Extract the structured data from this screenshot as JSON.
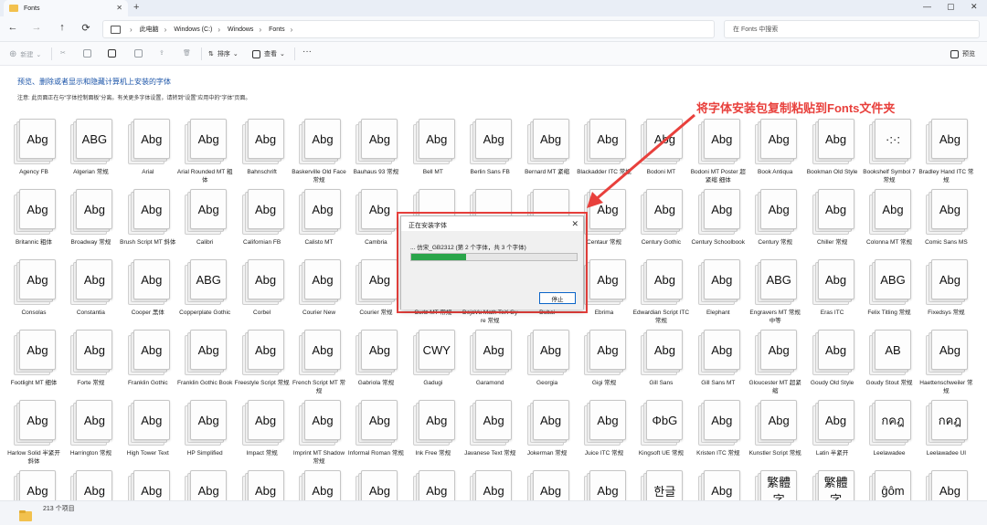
{
  "window": {
    "tab_title": "Fonts",
    "new_tab": "+",
    "controls": [
      "—",
      "▢",
      "✕"
    ]
  },
  "nav": {
    "back": "←",
    "forward": "→",
    "up": "↑",
    "refresh": "⟳",
    "breadcrumbs": [
      "此电脑",
      "Windows (C:)",
      "Windows",
      "Fonts"
    ],
    "search_placeholder": "在 Fonts 中搜索"
  },
  "commands": {
    "new": "新建",
    "sort": "排序",
    "view": "查看",
    "more": "···",
    "preview": "预览"
  },
  "info": {
    "title": "预览、删除或者显示和隐藏计算机上安装的字体",
    "note": "注意: 此页面正在与“字体控制面板”分离。有关更多字体设置，请转到“设置”应用中的“字体”页面。"
  },
  "annotation": {
    "text": "将字体安装包复制粘贴到Fonts文件夹",
    "color": "#e8403c"
  },
  "dialog": {
    "title": "正在安装字体",
    "close": "✕",
    "message": "... 仿宋_GB2312 (第 2 个字体，共 3 个字体)",
    "progress": 0.33,
    "stop_button": "停止"
  },
  "status": {
    "count": "213 个项目"
  },
  "fonts": [
    {
      "sample": "Abg",
      "label": "Agency FB"
    },
    {
      "sample": "ABG",
      "label": "Algerian 常规"
    },
    {
      "sample": "Abg",
      "label": "Arial"
    },
    {
      "sample": "Abg",
      "label": "Arial Rounded MT 粗体"
    },
    {
      "sample": "Abg",
      "label": "Bahnschrift"
    },
    {
      "sample": "Abg",
      "label": "Baskerville Old Face 常规"
    },
    {
      "sample": "Abg",
      "label": "Bauhaus 93 常规"
    },
    {
      "sample": "Abg",
      "label": "Bell MT"
    },
    {
      "sample": "Abg",
      "label": "Berlin Sans FB"
    },
    {
      "sample": "Abg",
      "label": "Bernard MT 紧缩"
    },
    {
      "sample": "Abg",
      "label": "Blackadder ITC 常规"
    },
    {
      "sample": "Abg",
      "label": "Bodoni MT"
    },
    {
      "sample": "Abg",
      "label": "Bodoni MT Poster 超紧缩 细体"
    },
    {
      "sample": "Abg",
      "label": "Book Antiqua"
    },
    {
      "sample": "Abg",
      "label": "Bookman Old Style"
    },
    {
      "sample": "·:·:",
      "label": "Bookshelf Symbol 7 常规"
    },
    {
      "sample": "Abg",
      "label": "Bradley Hand ITC 常规"
    },
    {
      "sample": "Abg",
      "label": "Britannic 粗体"
    },
    {
      "sample": "Abg",
      "label": "Broadway 常规"
    },
    {
      "sample": "Abg",
      "label": "Brush Script MT 斜体"
    },
    {
      "sample": "Abg",
      "label": "Calibri"
    },
    {
      "sample": "Abg",
      "label": "Californian FB"
    },
    {
      "sample": "Abg",
      "label": "Calisto MT"
    },
    {
      "sample": "Abg",
      "label": "Cambria"
    },
    {
      "sample": "",
      "label": ""
    },
    {
      "sample": "",
      "label": ""
    },
    {
      "sample": "",
      "label": ""
    },
    {
      "sample": "Abg",
      "label": "Centaur 常规"
    },
    {
      "sample": "Abg",
      "label": "Century Gothic"
    },
    {
      "sample": "Abg",
      "label": "Century Schoolbook"
    },
    {
      "sample": "Abg",
      "label": "Century 常规"
    },
    {
      "sample": "Abg",
      "label": "Chiller 常规"
    },
    {
      "sample": "Abg",
      "label": "Colonna MT 常规"
    },
    {
      "sample": "Abg",
      "label": "Comic Sans MS"
    },
    {
      "sample": "Abg",
      "label": "Consolas"
    },
    {
      "sample": "Abg",
      "label": "Constantia"
    },
    {
      "sample": "Abg",
      "label": "Cooper 黑体"
    },
    {
      "sample": "ABG",
      "label": "Copperplate Gothic"
    },
    {
      "sample": "Abg",
      "label": "Corbel"
    },
    {
      "sample": "Abg",
      "label": "Courier New"
    },
    {
      "sample": "Abg",
      "label": "Courier 常规"
    },
    {
      "sample": "",
      "label": "Curlz MT 常规"
    },
    {
      "sample": "",
      "label": "DejaVu Math TeX Gyre 常规"
    },
    {
      "sample": "",
      "label": "Dubai"
    },
    {
      "sample": "Abg",
      "label": "Ebrima"
    },
    {
      "sample": "Abg",
      "label": "Edwardian Script ITC 常规"
    },
    {
      "sample": "Abg",
      "label": "Elephant"
    },
    {
      "sample": "ABG",
      "label": "Engravers MT 常规 中等"
    },
    {
      "sample": "Abg",
      "label": "Eras ITC"
    },
    {
      "sample": "ABG",
      "label": "Felix Titling 常规"
    },
    {
      "sample": "Abg",
      "label": "Fixedsys 常规"
    },
    {
      "sample": "Abg",
      "label": "Footlight MT 细体"
    },
    {
      "sample": "Abg",
      "label": "Forte 常规"
    },
    {
      "sample": "Abg",
      "label": "Franklin Gothic"
    },
    {
      "sample": "Abg",
      "label": "Franklin Gothic Book"
    },
    {
      "sample": "Abg",
      "label": "Freestyle Script 常规"
    },
    {
      "sample": "Abg",
      "label": "French Script MT 常规"
    },
    {
      "sample": "Abg",
      "label": "Gabriola 常规"
    },
    {
      "sample": "CWY",
      "label": "Gadugi"
    },
    {
      "sample": "Abg",
      "label": "Garamond"
    },
    {
      "sample": "Abg",
      "label": "Georgia"
    },
    {
      "sample": "Abg",
      "label": "Gigi 常规"
    },
    {
      "sample": "Abg",
      "label": "Gill Sans"
    },
    {
      "sample": "Abg",
      "label": "Gill Sans MT"
    },
    {
      "sample": "Abg",
      "label": "Gloucester MT 超紧缩"
    },
    {
      "sample": "Abg",
      "label": "Goudy Old Style"
    },
    {
      "sample": "AB",
      "label": "Goudy Stout 常规"
    },
    {
      "sample": "Abg",
      "label": "Haettenschweiler 常规"
    },
    {
      "sample": "Abg",
      "label": "Harlow Solid 半紧开 斜体"
    },
    {
      "sample": "Abg",
      "label": "Harrington 常规"
    },
    {
      "sample": "Abg",
      "label": "High Tower Text"
    },
    {
      "sample": "Abg",
      "label": "HP Simplified"
    },
    {
      "sample": "Abg",
      "label": "Impact 常规"
    },
    {
      "sample": "Abg",
      "label": "Imprint MT Shadow 常规"
    },
    {
      "sample": "Abg",
      "label": "Informal Roman 常规"
    },
    {
      "sample": "Abg",
      "label": "Ink Free 常规"
    },
    {
      "sample": "Abg",
      "label": "Javanese Text 常规"
    },
    {
      "sample": "Abg",
      "label": "Jokerman 常规"
    },
    {
      "sample": "Abg",
      "label": "Juice ITC 常规"
    },
    {
      "sample": "ΦbG",
      "label": "Kingsoft UE 常规"
    },
    {
      "sample": "Abg",
      "label": "Kristen ITC 常规"
    },
    {
      "sample": "Abg",
      "label": "Kunstler Script 常规"
    },
    {
      "sample": "Abg",
      "label": "Latin 半紧开"
    },
    {
      "sample": "กคฎ",
      "label": "Leelawadee"
    },
    {
      "sample": "กคฎ",
      "label": "Leelawadee UI"
    },
    {
      "sample": "Abg",
      "label": ""
    },
    {
      "sample": "Abg",
      "label": ""
    },
    {
      "sample": "Abg",
      "label": ""
    },
    {
      "sample": "Abg",
      "label": ""
    },
    {
      "sample": "Abg",
      "label": ""
    },
    {
      "sample": "Abg",
      "label": ""
    },
    {
      "sample": "Abg",
      "label": ""
    },
    {
      "sample": "Abg",
      "label": ""
    },
    {
      "sample": "Abg",
      "label": ""
    },
    {
      "sample": "Abg",
      "label": ""
    },
    {
      "sample": "Abg",
      "label": ""
    },
    {
      "sample": "한글",
      "label": ""
    },
    {
      "sample": "Abg",
      "label": ""
    },
    {
      "sample": "繁體字",
      "label": ""
    },
    {
      "sample": "繁體字",
      "label": ""
    },
    {
      "sample": "ĝôm",
      "label": ""
    },
    {
      "sample": "Abg",
      "label": ""
    }
  ]
}
